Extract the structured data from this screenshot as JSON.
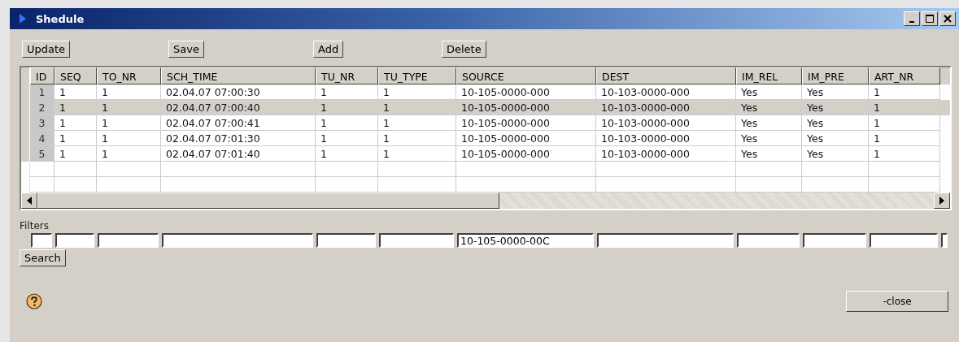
{
  "window": {
    "title": "Shedule"
  },
  "toolbar": [
    "Update",
    "Save",
    "Add",
    "Delete"
  ],
  "table": {
    "columns": [
      "ID",
      "SEQ",
      "TO_NR",
      "SCH_TIME",
      "TU_NR",
      "TU_TYPE",
      "SOURCE",
      "DEST",
      "IM_REL",
      "IM_PRE",
      "ART_NR"
    ],
    "rows": [
      {
        "selected": false,
        "cells": [
          "1",
          "1",
          "1",
          "02.04.07 07:00:30",
          "1",
          "1",
          "10-105-0000-000",
          "10-103-0000-000",
          "Yes",
          "Yes",
          "1"
        ]
      },
      {
        "selected": true,
        "cells": [
          "2",
          "1",
          "1",
          "02.04.07 07:00:40",
          "1",
          "1",
          "10-105-0000-000",
          "10-103-0000-000",
          "Yes",
          "Yes",
          "1"
        ]
      },
      {
        "selected": false,
        "cells": [
          "3",
          "1",
          "1",
          "02.04.07 07:00:41",
          "1",
          "1",
          "10-105-0000-000",
          "10-103-0000-000",
          "Yes",
          "Yes",
          "1"
        ]
      },
      {
        "selected": false,
        "cells": [
          "4",
          "1",
          "1",
          "02.04.07 07:01:30",
          "1",
          "1",
          "10-105-0000-000",
          "10-103-0000-000",
          "Yes",
          "Yes",
          "1"
        ]
      },
      {
        "selected": false,
        "cells": [
          "5",
          "1",
          "1",
          "02.04.07 07:01:40",
          "1",
          "1",
          "10-105-0000-000",
          "10-103-0000-000",
          "Yes",
          "Yes",
          "1"
        ]
      }
    ]
  },
  "filters": {
    "label": "Filters",
    "fields": [
      {
        "kind": "empty"
      },
      {
        "kind": "empty"
      },
      {
        "kind": "empty"
      },
      {
        "kind": "empty"
      },
      {
        "kind": "empty"
      },
      {
        "kind": "empty"
      },
      {
        "kind": "text",
        "value": "10-105-0000-00C"
      },
      {
        "kind": "empty"
      },
      {
        "kind": "empty"
      },
      {
        "kind": "empty"
      },
      {
        "kind": "empty"
      },
      {
        "kind": "empty"
      }
    ]
  },
  "search_button": "Search",
  "close_button": "-close"
}
